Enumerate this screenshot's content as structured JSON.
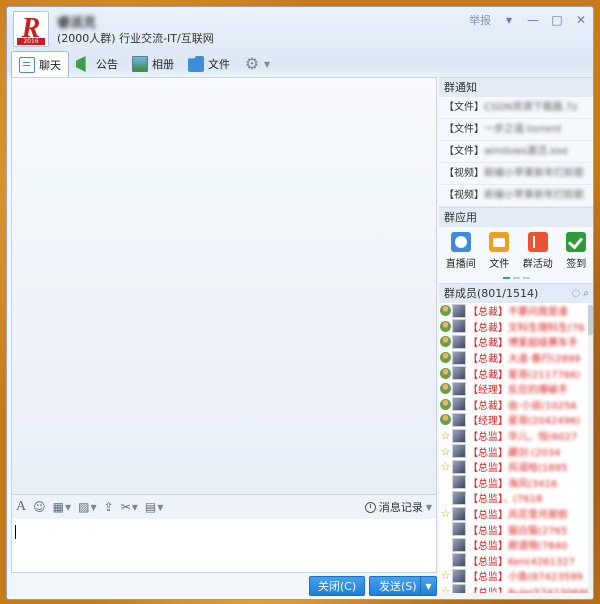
{
  "header": {
    "group_name": "睿派克",
    "group_subtitle": "(2000人群) 行业交流-IT/互联网",
    "logo_letter": "R",
    "logo_year": "2016",
    "report_label": "举报"
  },
  "tabs": [
    {
      "label": "聊天",
      "icon": "chat-icon"
    },
    {
      "label": "公告",
      "icon": "notice-flag-icon"
    },
    {
      "label": "相册",
      "icon": "album-icon"
    },
    {
      "label": "文件",
      "icon": "folder-icon"
    }
  ],
  "input_toolbar": {
    "history_label": "消息记录"
  },
  "buttons": {
    "close_label": "关闭(C)",
    "send_label": "发送(S)"
  },
  "sidebar": {
    "notice_header": "群通知",
    "notices": [
      {
        "type": "【文件】",
        "text": "CSDN资源下载器.7z"
      },
      {
        "type": "【文件】",
        "text": "一步之遥.torrent"
      },
      {
        "type": "【文件】",
        "text": "windows激活.exe"
      },
      {
        "type": "【视频】",
        "text": "新编小苹果新年打脸歌"
      },
      {
        "type": "【视频】",
        "text": "新编小苹果新年打脸歌"
      }
    ],
    "apps_header": "群应用",
    "apps": [
      {
        "label": "直播间",
        "icon": "live-room-icon"
      },
      {
        "label": "文件",
        "icon": "file-app-icon"
      },
      {
        "label": "群活动",
        "icon": "group-activity-icon"
      },
      {
        "label": "签到",
        "icon": "checkin-icon"
      }
    ],
    "members_header": "群成员(801/1514)",
    "members": [
      {
        "role": "owner",
        "tag": "【总裁】",
        "name": "不要问我是谁"
      },
      {
        "role": "owner",
        "tag": "【总裁】",
        "name": "文科生理科生(76"
      },
      {
        "role": "owner",
        "tag": "【总裁】",
        "name": "博爱超级赛车手"
      },
      {
        "role": "owner",
        "tag": "【总裁】",
        "name": "大道·善行(2899"
      },
      {
        "role": "owner",
        "tag": "【总裁】",
        "name": "星哥(2117766)"
      },
      {
        "role": "owner",
        "tag": "【经理】",
        "name": "反应的爆破手"
      },
      {
        "role": "owner",
        "tag": "【总裁】",
        "name": "由·小说(10256"
      },
      {
        "role": "owner",
        "tag": "【经理】",
        "name": "星哥(2042496)"
      },
      {
        "role": "admin",
        "tag": "【总监】",
        "name": "华儿，恒(6027"
      },
      {
        "role": "admin",
        "tag": "【总监】",
        "name": "藏剑·(2034"
      },
      {
        "role": "admin",
        "tag": "【总监】",
        "name": "风谣哈(1895"
      },
      {
        "role": "none",
        "tag": "【总监】",
        "name": "海风(3416"
      },
      {
        "role": "none",
        "tag": "【总监】",
        "name": "。(7618"
      },
      {
        "role": "admin",
        "tag": "【总监】",
        "name": "风花雪月那些"
      },
      {
        "role": "none",
        "tag": "【总监】",
        "name": "猫白猫(2765"
      },
      {
        "role": "none",
        "tag": "【总监】",
        "name": "廊道哦(7840"
      },
      {
        "role": "none",
        "tag": "【总监】",
        "name": "Ken(4261327"
      },
      {
        "role": "admin",
        "tag": "【总监】",
        "name": "小鱼(87423599"
      },
      {
        "role": "admin",
        "tag": "【总监】",
        "name": "Bule(574230699"
      }
    ]
  },
  "colors": {
    "accent": "#1e7fd8",
    "member_name": "#d82020"
  }
}
